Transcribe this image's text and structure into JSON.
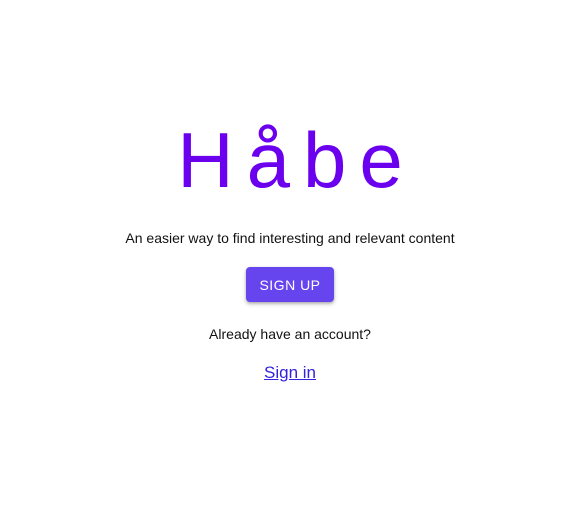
{
  "brand": {
    "logo_text": "Håbe",
    "tagline": "An easier way to find interesting and relevant content"
  },
  "actions": {
    "signup_label": "SIGN UP",
    "already_text": "Already have an account?",
    "signin_label": "Sign in"
  },
  "colors": {
    "brand": "#6a00ee",
    "button": "#6644ee",
    "link": "#3322dd"
  }
}
